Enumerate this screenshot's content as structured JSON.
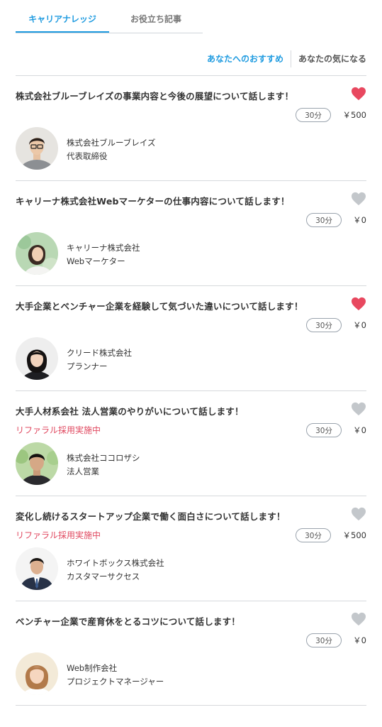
{
  "tabs": [
    {
      "label": "キャリアナレッジ",
      "active": true
    },
    {
      "label": "お役立ち記事",
      "active": false
    }
  ],
  "subtabs": [
    {
      "label": "あなたへのおすすめ",
      "active": true
    },
    {
      "label": "あなたの気になる",
      "active": false
    }
  ],
  "colors": {
    "accent": "#1f9be0",
    "heart_on": "#e8485f",
    "heart_off": "#c3c7cb",
    "referral": "#e0485f"
  },
  "items": [
    {
      "title": "株式会社ブルーブレイズの事業内容と今後の展望について話します！",
      "favorited": true,
      "referral": "",
      "duration": "30分",
      "price": "￥500",
      "company": "株式会社ブルーブレイズ",
      "role": "代表取締役",
      "avatar_icon": "man-glasses-portrait"
    },
    {
      "title": "キャリーナ株式会社Webマーケターの仕事内容について話します！",
      "favorited": false,
      "referral": "",
      "duration": "30分",
      "price": "￥0",
      "company": "キャリーナ株式会社",
      "role": "Webマーケター",
      "avatar_icon": "woman-outdoor-portrait"
    },
    {
      "title": "大手企業とベンチャー企業を経験して気づいた違いについて話します！",
      "favorited": true,
      "referral": "",
      "duration": "30分",
      "price": "￥0",
      "company": "クリード株式会社",
      "role": "プランナー",
      "avatar_icon": "woman-portrait"
    },
    {
      "title": "大手人材系会社 法人営業のやりがいについて話します！",
      "favorited": false,
      "referral": "リファラル採用実施中",
      "duration": "30分",
      "price": "￥0",
      "company": "株式会社ココロザシ",
      "role": "法人営業",
      "avatar_icon": "man-outdoor-portrait"
    },
    {
      "title": "変化し続けるスタートアップ企業で働く面白さについて話します！",
      "favorited": false,
      "referral": "リファラル採用実施中",
      "duration": "30分",
      "price": "￥500",
      "company": "ホワイトボックス株式会社",
      "role": "カスタマーサクセス",
      "avatar_icon": "man-suit-portrait"
    },
    {
      "title": "ベンチャー企業で産育休をとるコツについて話します！",
      "favorited": false,
      "referral": "",
      "duration": "30分",
      "price": "￥0",
      "company": "Web制作会社",
      "role": "プロジェクトマネージャー",
      "avatar_icon": "woman-smile-portrait"
    }
  ]
}
